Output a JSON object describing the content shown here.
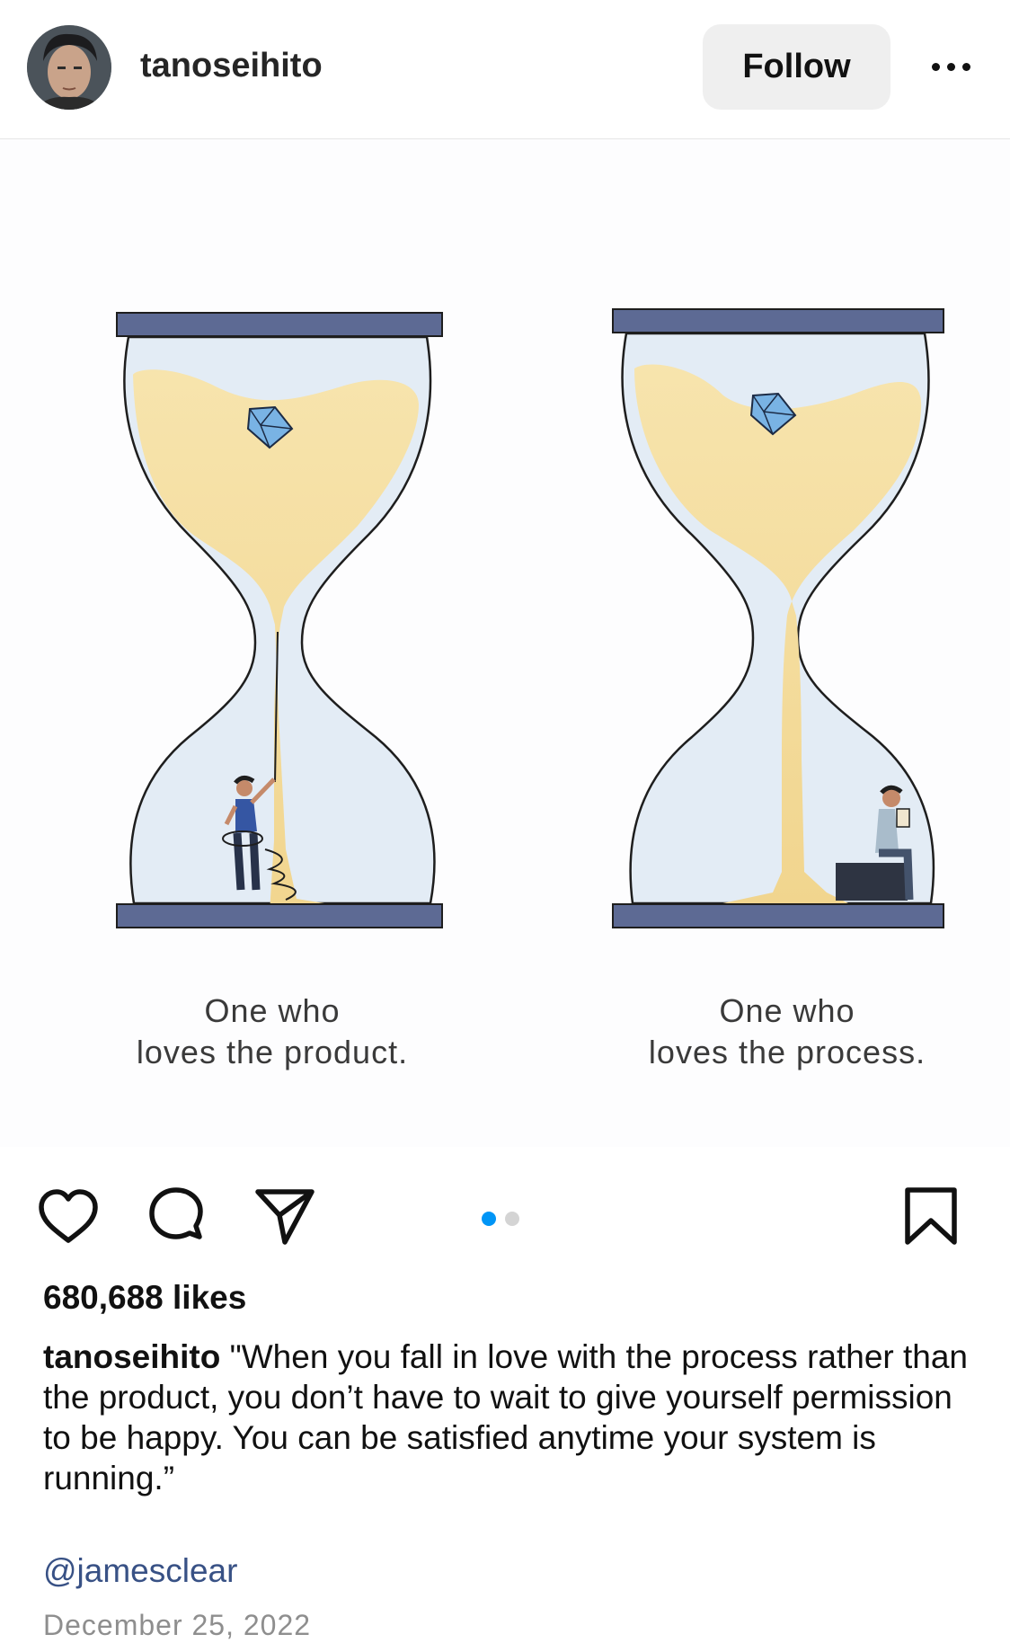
{
  "header": {
    "username": "tanoseihito",
    "follow_label": "Follow"
  },
  "illustration": {
    "left_caption": [
      "One who",
      "loves the product."
    ],
    "right_caption": [
      "One who",
      "loves the process."
    ]
  },
  "actions": {
    "carousel_total": 2,
    "carousel_active": 1
  },
  "post": {
    "likes": "680,688 likes",
    "caption_user": "tanoseihito",
    "caption_text": "\"When you fall in love with the process rather than the product, you don’t have to wait to give yourself permission to be happy. You can be satisfied anytime your system is running.”",
    "mention": "@jamesclear",
    "date": "December 25, 2022"
  },
  "colors": {
    "accent": "#0095f6",
    "sand": "#f5dfa0",
    "glass": "#e3ecf5",
    "hourglass_cap": "#5d6a94"
  }
}
